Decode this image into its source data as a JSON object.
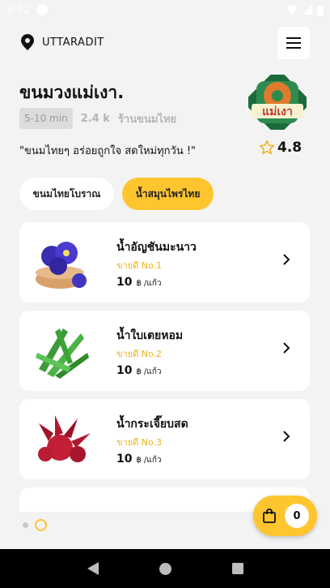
{
  "status": {
    "time": "9:52"
  },
  "header": {
    "location": "UTTARADIT",
    "menu_icon": "hamburger-icon"
  },
  "store": {
    "name": "ขนมวงแม่เงา.",
    "time": "5-10 min",
    "distance": "2.4 k",
    "category": "ร้านขนมไทย",
    "tagline": "\"ขนมไทยๆ อร่อยถูกใจ สดใหม่ทุกวัน !\"",
    "rating": "4.8",
    "logo_text": "แม่เงา"
  },
  "tabs": [
    {
      "label": "ขนมไทยโบราณ"
    },
    {
      "label": "น้ำสมุนไพรไทย"
    }
  ],
  "products": [
    {
      "name": "น้ำอัญชันมะนาว",
      "rank": "ขายดี No.1",
      "price": "10",
      "unit": "฿ /แก้ว"
    },
    {
      "name": "น้ำใบเตยหอม",
      "rank": "ขายดี No.2",
      "price": "10",
      "unit": "฿ /แก้ว"
    },
    {
      "name": "น้ำกระเจี๊ยบสด",
      "rank": "ขายดี No.3",
      "price": "10",
      "unit": "฿ /แก้ว"
    }
  ],
  "cart": {
    "count": "0"
  },
  "colors": {
    "accent": "#ffc52e",
    "background": "#f3f3f3"
  }
}
